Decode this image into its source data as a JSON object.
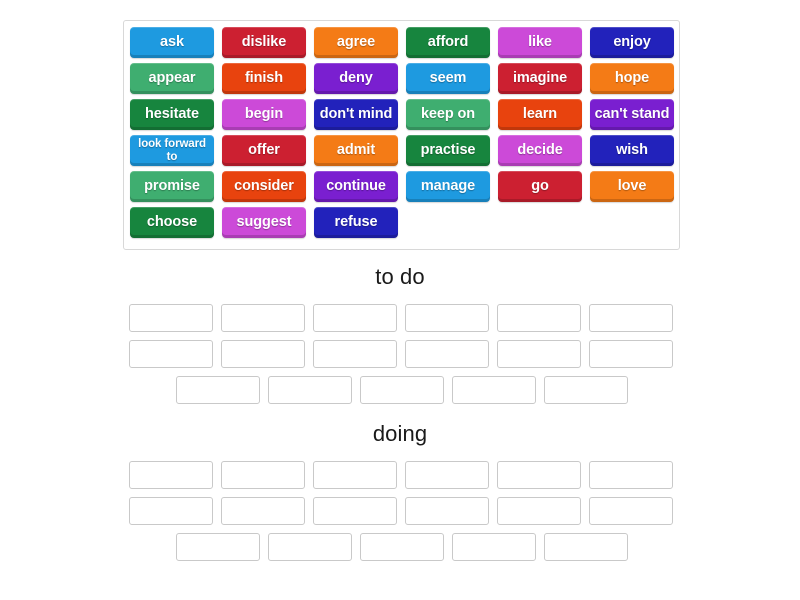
{
  "activity": {
    "type": "group-sort",
    "background_color": "#ffffff"
  },
  "word_bank": {
    "name": "word-bank",
    "border_color": "#d8d8d8",
    "rows": [
      [
        {
          "label": "ask",
          "color": "#1e9ae0"
        },
        {
          "label": "dislike",
          "color": "#cc2031"
        },
        {
          "label": "agree",
          "color": "#f47b16"
        },
        {
          "label": "afford",
          "color": "#17853e"
        },
        {
          "label": "like",
          "color": "#cc4ad8"
        },
        {
          "label": "enjoy",
          "color": "#2222bb"
        }
      ],
      [
        {
          "label": "appear",
          "color": "#3fae70"
        },
        {
          "label": "finish",
          "color": "#e8430e"
        },
        {
          "label": "deny",
          "color": "#7a1fd0"
        },
        {
          "label": "seem",
          "color": "#1e9ae0"
        },
        {
          "label": "imagine",
          "color": "#cc2031"
        },
        {
          "label": "hope",
          "color": "#f47b16"
        }
      ],
      [
        {
          "label": "hesitate",
          "color": "#17853e"
        },
        {
          "label": "begin",
          "color": "#cc4ad8"
        },
        {
          "label": "don't mind",
          "color": "#2222bb"
        },
        {
          "label": "keep on",
          "color": "#3fae70"
        },
        {
          "label": "learn",
          "color": "#e8430e"
        },
        {
          "label": "can't stand",
          "color": "#7a1fd0"
        }
      ],
      [
        {
          "label": "look forward to",
          "color": "#1e9ae0",
          "small": true
        },
        {
          "label": "offer",
          "color": "#cc2031"
        },
        {
          "label": "admit",
          "color": "#f47b16"
        },
        {
          "label": "practise",
          "color": "#17853e"
        },
        {
          "label": "decide",
          "color": "#cc4ad8"
        },
        {
          "label": "wish",
          "color": "#2222bb"
        }
      ],
      [
        {
          "label": "promise",
          "color": "#3fae70"
        },
        {
          "label": "consider",
          "color": "#e8430e"
        },
        {
          "label": "continue",
          "color": "#7a1fd0"
        },
        {
          "label": "manage",
          "color": "#1e9ae0"
        },
        {
          "label": "go",
          "color": "#cc2031"
        },
        {
          "label": "love",
          "color": "#f47b16"
        }
      ],
      [
        {
          "label": "choose",
          "color": "#17853e"
        },
        {
          "label": "suggest",
          "color": "#cc4ad8"
        },
        {
          "label": "refuse",
          "color": "#2222bb"
        }
      ]
    ]
  },
  "groups": [
    {
      "title": "to do",
      "slot_rows": [
        {
          "count": 6,
          "indented": false
        },
        {
          "count": 6,
          "indented": false
        },
        {
          "count": 5,
          "indented": true
        }
      ]
    },
    {
      "title": "doing",
      "slot_rows": [
        {
          "count": 6,
          "indented": false
        },
        {
          "count": 6,
          "indented": false
        },
        {
          "count": 5,
          "indented": true
        }
      ]
    }
  ]
}
